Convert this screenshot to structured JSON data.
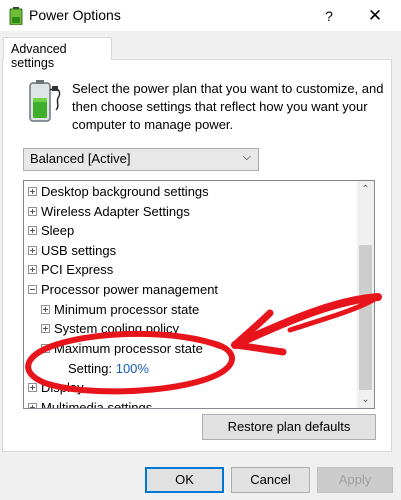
{
  "window": {
    "title": "Power Options",
    "help_glyph": "?",
    "close_glyph": "✕"
  },
  "tab": {
    "label": "Advanced settings"
  },
  "description": "Select the power plan that you want to customize, and then choose settings that reflect how you want your computer to manage power.",
  "plan_select": {
    "value": "Balanced [Active]",
    "arrow": "⌵"
  },
  "tree": {
    "items": [
      {
        "label": "Desktop background settings"
      },
      {
        "label": "Wireless Adapter Settings"
      },
      {
        "label": "Sleep"
      },
      {
        "label": "USB settings"
      },
      {
        "label": "PCI Express"
      },
      {
        "label": "Processor power management"
      },
      {
        "label": "Minimum processor state"
      },
      {
        "label": "System cooling policy"
      },
      {
        "label": "Maximum processor state"
      },
      {
        "setting_label": "Setting:",
        "setting_value": "100%"
      },
      {
        "label": "Display"
      },
      {
        "label": "Multimedia settings"
      }
    ],
    "scroll_up": "⌃",
    "scroll_down": "⌄"
  },
  "buttons": {
    "restore": "Restore plan defaults",
    "ok": "OK",
    "cancel": "Cancel",
    "apply": "Apply"
  },
  "colors": {
    "annotation": "#e8141b",
    "link_value": "#1a5fb4",
    "focus_border": "#0078d7"
  }
}
